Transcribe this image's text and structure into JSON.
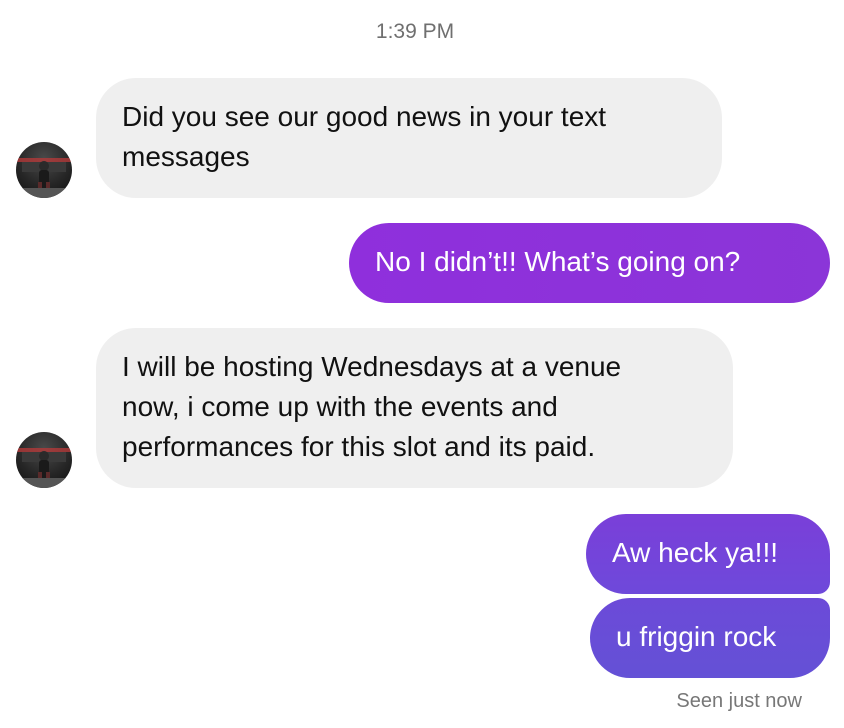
{
  "thread": {
    "timestamp": "1:39 PM",
    "messages": [
      {
        "sender": "contact",
        "text": "Did you see our good news in your text\nmessages"
      },
      {
        "sender": "me",
        "text": "No I didn’t!! What’s going on?"
      },
      {
        "sender": "contact",
        "text": "I will be hosting Wednesdays at a venue\nnow, i come up with the events and\nperformances for this slot and its paid."
      },
      {
        "sender": "me",
        "text": "Aw heck ya!!!"
      },
      {
        "sender": "me",
        "text": "u friggin rock"
      }
    ],
    "read_receipt": "Seen just now"
  },
  "colors": {
    "incoming_bubble": "#efefef",
    "outgoing_bubble_purple": "#8f2fdc",
    "outgoing_bubble_violet": "#6451d6",
    "timestamp_text": "#6f6f6f"
  },
  "icons": {
    "contact_avatar": "profile-photo"
  }
}
